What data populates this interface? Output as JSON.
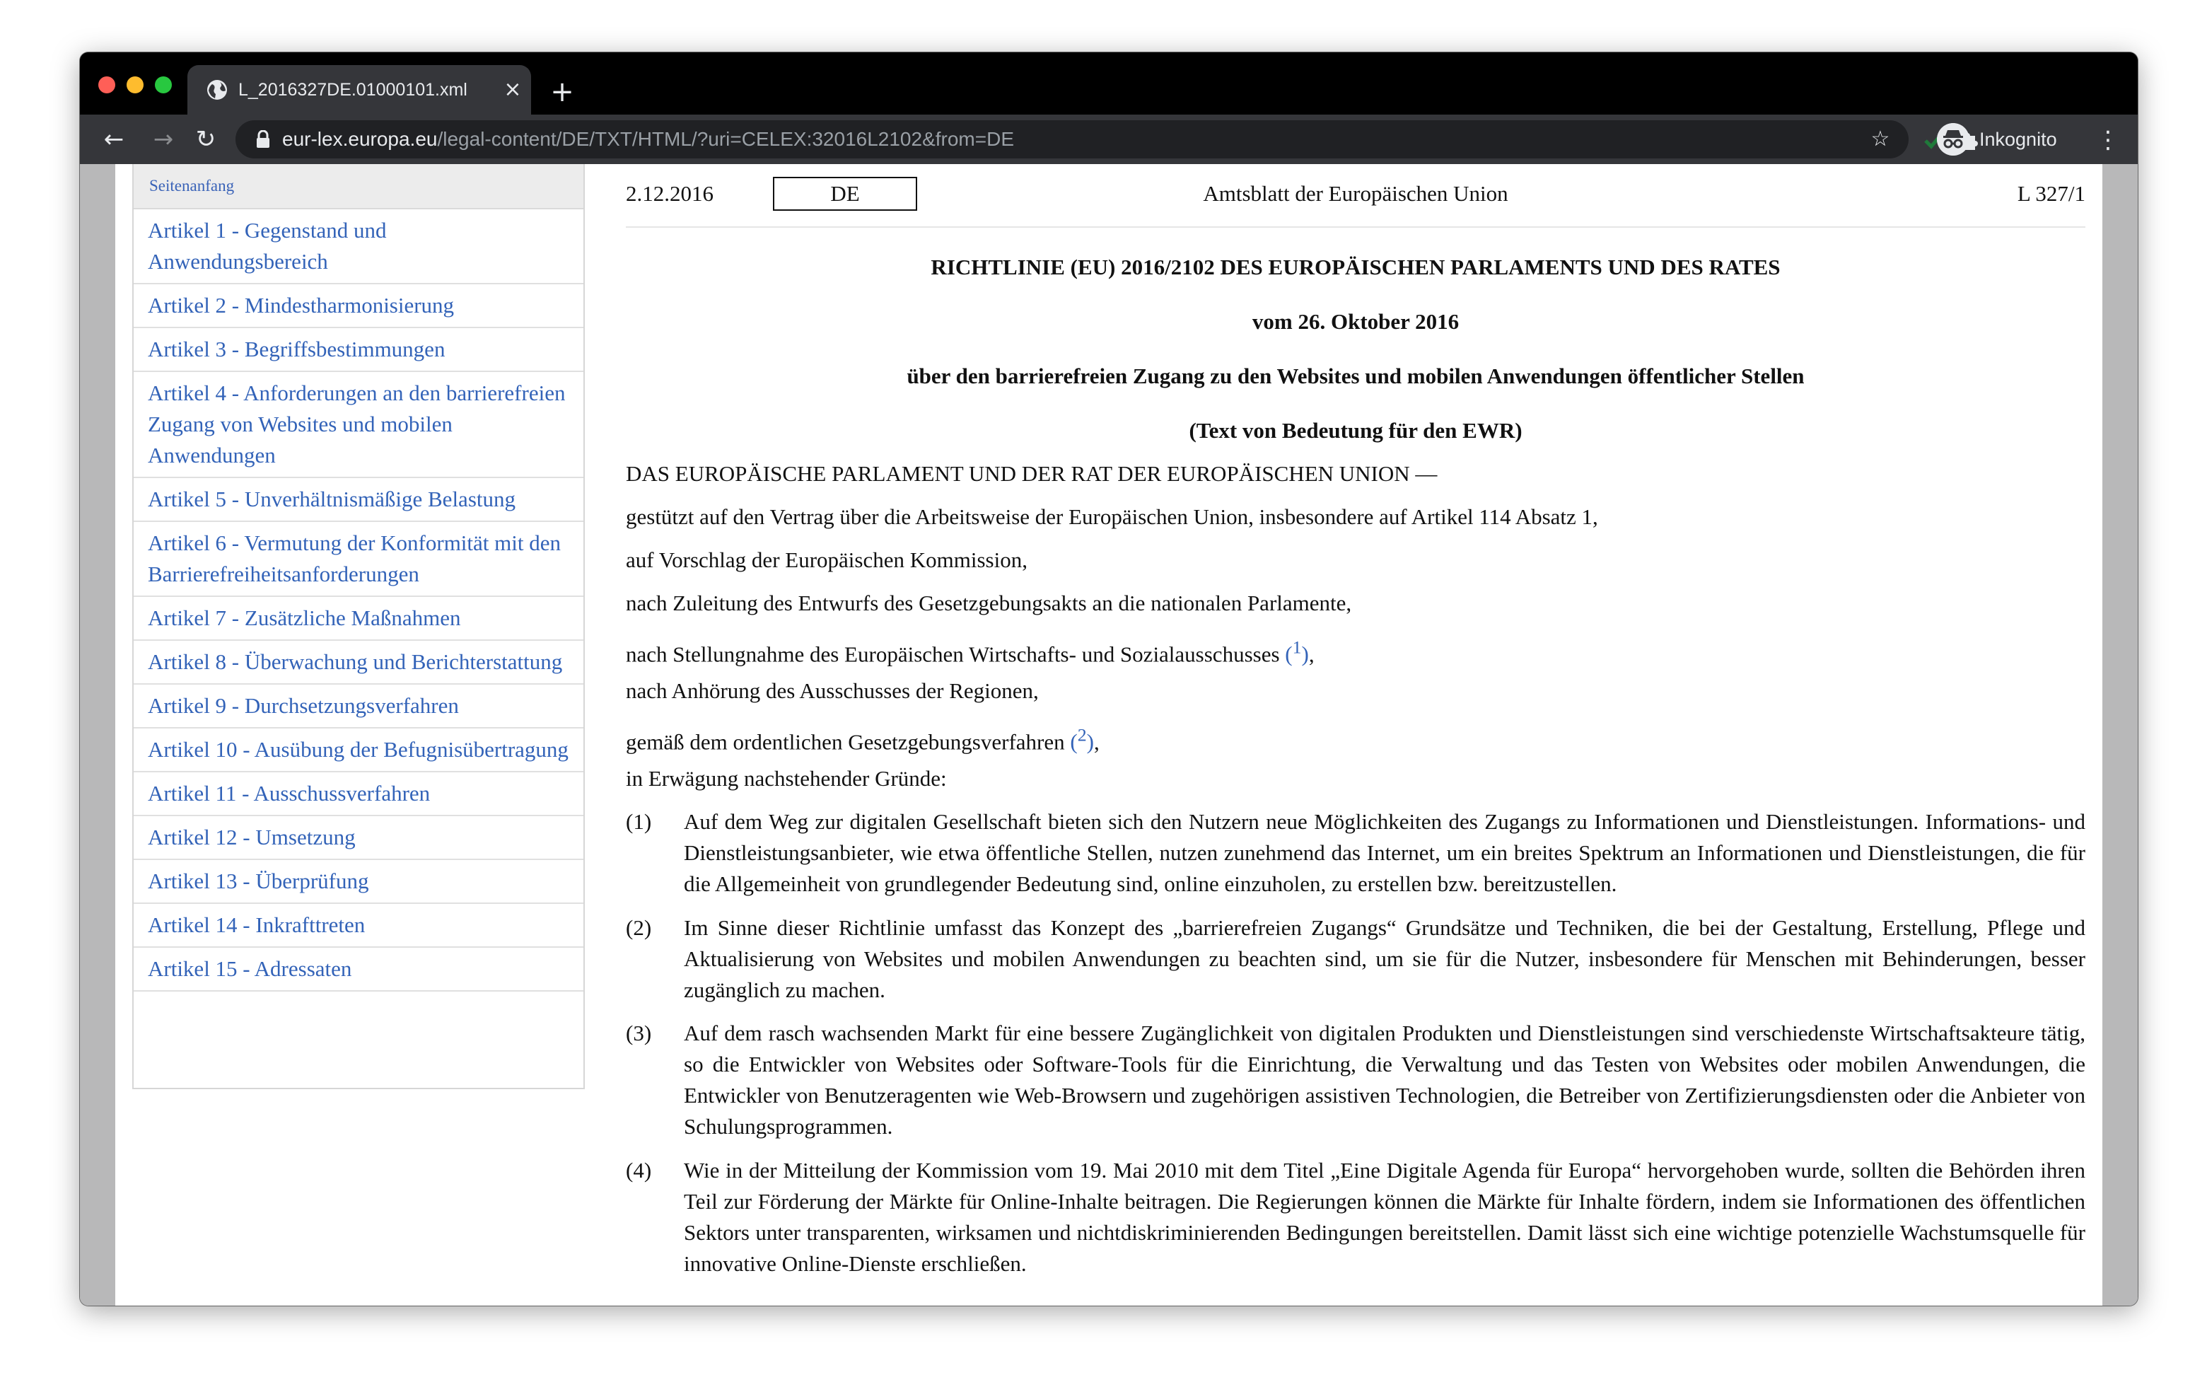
{
  "browser": {
    "tab_title": "L_2016327DE.01000101.xml",
    "url_host": "eur-lex.europa.eu",
    "url_path": "/legal-content/DE/TXT/HTML/?uri=CELEX:32016L2102&from=DE",
    "profile_label": "Inkognito"
  },
  "sidebar": {
    "top_link": "Seitenanfang",
    "items": [
      "Artikel 1 - Gegenstand und Anwendungsbereich",
      "Artikel 2 - Mindestharmonisierung",
      "Artikel 3 - Begriffsbestimmungen",
      "Artikel 4 - Anforderungen an den barrierefreien Zugang von Websites und mobilen Anwendungen",
      "Artikel 5 - Unverhältnismäßige Belastung",
      "Artikel 6 - Vermutung der Konformität mit den Barrierefreiheitsanforderungen",
      "Artikel 7 - Zusätzliche Maßnahmen",
      "Artikel 8 - Überwachung und Berichterstattung",
      "Artikel 9 - Durchsetzungsverfahren",
      "Artikel 10 - Ausübung der Befugnisübertragung",
      "Artikel 11 - Ausschussverfahren",
      "Artikel 12 - Umsetzung",
      "Artikel 13 - Überprüfung",
      "Artikel 14 - Inkrafttreten",
      "Artikel 15 - Adressaten"
    ]
  },
  "document": {
    "header": {
      "date": "2.12.2016",
      "lang": "DE",
      "journal": "Amtsblatt der Europäischen Union",
      "page": "L 327/1"
    },
    "title": "RICHTLINIE (EU) 2016/2102 DES EUROPÄISCHEN PARLAMENTS UND DES RATES",
    "date_line": "vom 26. Oktober 2016",
    "subject": "über den barrierefreien Zugang zu den Websites und mobilen Anwendungen öffentlicher Stellen",
    "eea": "(Text von Bedeutung für den EWR)",
    "preamble": "DAS EUROPÄISCHE PARLAMENT UND DER RAT DER EUROPÄISCHEN UNION —",
    "citations": [
      "gestützt auf den Vertrag über die Arbeitsweise der Europäischen Union, insbesondere auf Artikel 114 Absatz 1,",
      "auf Vorschlag der Europäischen Kommission,",
      "nach Zuleitung des Entwurfs des Gesetzgebungsakts an die nationalen Parlamente,"
    ],
    "citation_fn1_text": "nach Stellungnahme des Europäischen Wirtschafts- und Sozialausschusses ",
    "citation_fn1_mark": "1",
    "citation_regions": "nach Anhörung des Ausschusses der Regionen,",
    "citation_fn2_text": "gemäß dem ordentlichen Gesetzgebungsverfahren ",
    "citation_fn2_mark": "2",
    "whereas": "in Erwägung nachstehender Gründe:",
    "recitals": [
      {
        "num": "(1)",
        "text": "Auf dem Weg zur digitalen Gesellschaft bieten sich den Nutzern neue Möglichkeiten des Zugangs zu Informationen und Dienstleistungen. Informations- und Dienstleistungsanbieter, wie etwa öffentliche Stellen, nutzen zunehmend das Internet, um ein breites Spektrum an Informationen und Dienstleistungen, die für die Allgemeinheit von grundlegender Bedeutung sind, online einzuholen, zu erstellen bzw. bereitzustellen."
      },
      {
        "num": "(2)",
        "text": "Im Sinne dieser Richtlinie umfasst das Konzept des „barrierefreien Zugangs“ Grundsätze und Techniken, die bei der Gestaltung, Erstellung, Pflege und Aktualisierung von Websites und mobilen Anwendungen zu beachten sind, um sie für die Nutzer, insbesondere für Menschen mit Behinderungen, besser zugänglich zu machen."
      },
      {
        "num": "(3)",
        "text": "Auf dem rasch wachsenden Markt für eine bessere Zugänglichkeit von digitalen Produkten und Dienstleistungen sind verschiedenste Wirtschaftsakteure tätig, so die Entwickler von Websites oder Software-Tools für die Einrichtung, die Verwaltung und das Testen von Websites oder mobilen Anwendungen, die Entwickler von Benutzeragenten wie Web-Browsern und zugehörigen assistiven Technologien, die Betreiber von Zertifizierungsdiensten oder die Anbieter von Schulungsprogrammen."
      },
      {
        "num": "(4)",
        "text": "Wie in der Mitteilung der Kommission vom 19. Mai 2010 mit dem Titel „Eine Digitale Agenda für Europa“ hervorgehoben wurde, sollten die Behörden ihren Teil zur Förderung der Märkte für Online-Inhalte beitragen. Die Regierungen können die Märkte für Inhalte fördern, indem sie Informationen des öffentlichen Sektors unter transparenten, wirksamen und nichtdiskriminierenden Bedingungen bereitstellen. Damit lässt sich eine wichtige potenzielle Wachstumsquelle für innovative Online-Dienste erschließen."
      }
    ]
  }
}
